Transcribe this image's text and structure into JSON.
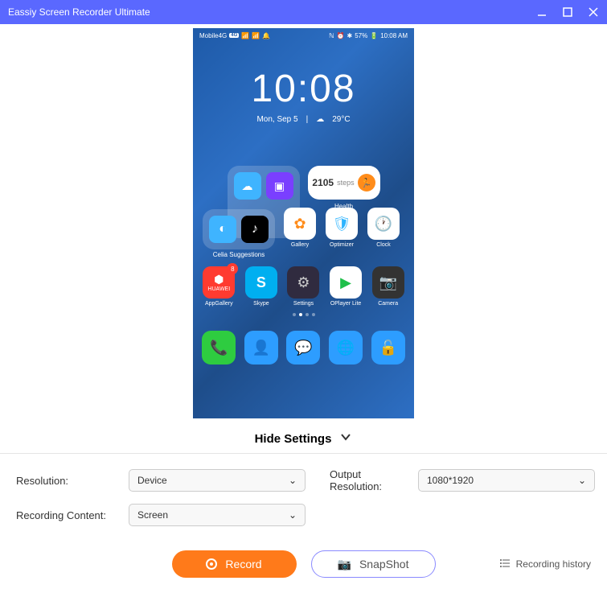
{
  "titlebar": {
    "title": "Eassiy Screen Recorder Ultimate"
  },
  "phone": {
    "status": {
      "carrier": "Mobile4G",
      "net_badge": "4G",
      "battery_text": "57%",
      "bt_icon": "✱",
      "time": "10:08 AM"
    },
    "clock": {
      "time": "10:08",
      "date": "Mon, Sep 5",
      "weather_icon": "☁",
      "temp": "29°C"
    },
    "health": {
      "steps": "2105",
      "unit": "steps",
      "label": "Health"
    },
    "folder_label": "Celia Suggestions",
    "apps_row1": [
      {
        "label": "Gallery",
        "icon": "✿",
        "bg": "#fff",
        "fg": "#ff8c1a"
      },
      {
        "label": "Optimizer",
        "icon": "🛡",
        "bg": "#fff",
        "fg": "#2db4ff"
      },
      {
        "label": "Clock",
        "icon": "🕐",
        "bg": "#fff",
        "fg": "#333"
      }
    ],
    "apps_row2": [
      {
        "label": "AppGallery",
        "icon": "H",
        "bg": "#ff3b30",
        "fg": "#fff",
        "badge": "8",
        "sub": "HUAWEI"
      },
      {
        "label": "Skype",
        "icon": "S",
        "bg": "#00aff0",
        "fg": "#fff"
      },
      {
        "label": "Settings",
        "icon": "⚙",
        "bg": "#302b3f",
        "fg": "#ccc"
      },
      {
        "label": "OPlayer Lite",
        "icon": "▶",
        "bg": "#fff",
        "fg": "#1fbf4a"
      },
      {
        "label": "Camera",
        "icon": "📷",
        "bg": "#333",
        "fg": "#fff"
      }
    ],
    "dock": [
      {
        "name": "phone",
        "icon": "📞",
        "bg": "#2ecc40"
      },
      {
        "name": "contacts",
        "icon": "👤",
        "bg": "#2d9dff"
      },
      {
        "name": "messages",
        "icon": "💬",
        "bg": "#2d9dff"
      },
      {
        "name": "browser",
        "icon": "🌐",
        "bg": "#2d9dff"
      },
      {
        "name": "lock",
        "icon": "🔓",
        "bg": "#2d9dff"
      }
    ],
    "suggest_icons": [
      {
        "bg": "#3fb4ff",
        "icon": "◐"
      },
      {
        "bg": "#000",
        "icon": "♪"
      }
    ],
    "folder_icons": [
      {
        "bg": "#3fb4ff",
        "icon": "☁"
      },
      {
        "bg": "#7a3fff",
        "icon": "▣"
      }
    ]
  },
  "toggle": {
    "label": "Hide Settings"
  },
  "settings": {
    "resolution_label": "Resolution:",
    "resolution_value": "Device",
    "output_label": "Output Resolution:",
    "output_value": "1080*1920",
    "content_label": "Recording Content:",
    "content_value": "Screen"
  },
  "buttons": {
    "record": "Record",
    "snapshot": "SnapShot",
    "history": "Recording history"
  }
}
